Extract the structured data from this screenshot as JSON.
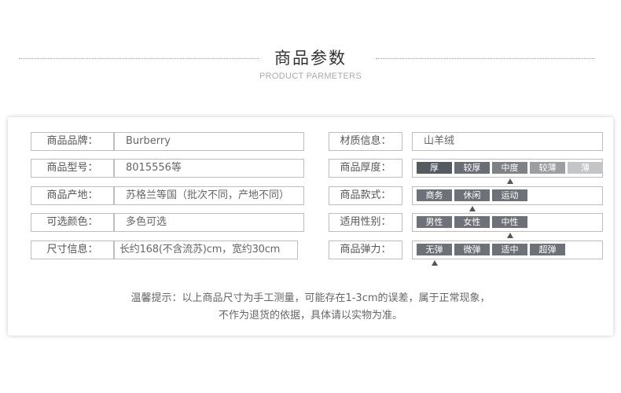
{
  "header": {
    "title": "商品参数",
    "subtitle": "PRODUCT PARMETERS"
  },
  "left_rows": [
    {
      "label": "商品品牌：",
      "value": "Burberry"
    },
    {
      "label": "商品型号：",
      "value": "8015556等"
    },
    {
      "label": "商品产地：",
      "value": "苏格兰等国（批次不同，产地不同）"
    },
    {
      "label": "可选颜色：",
      "value": "多色可选"
    },
    {
      "label": "尺寸信息：",
      "value": "长约168(不含流苏)cm，宽约30cm"
    }
  ],
  "material": {
    "label": "材质信息：",
    "value": "山羊绒"
  },
  "scales": [
    {
      "label": "商品厚度：",
      "options": [
        "厚",
        "较厚",
        "中度",
        "较薄",
        "薄"
      ],
      "selected_index": 2,
      "colors": [
        "#555a61",
        "#6a6e74",
        "#7e8286",
        "#9c9ea1",
        "#c4c5c7"
      ]
    },
    {
      "label": "商品款式：",
      "options": [
        "商务",
        "休闲",
        "运动"
      ],
      "selected_index": 1,
      "colors": [
        "#6e7278",
        "#6e7278",
        "#6e7278"
      ]
    },
    {
      "label": "适用性别：",
      "options": [
        "男性",
        "女性",
        "中性"
      ],
      "selected_index": 2,
      "colors": [
        "#6e7278",
        "#6e7278",
        "#6e7278"
      ]
    },
    {
      "label": "商品弹力：",
      "options": [
        "无弹",
        "微弹",
        "适中",
        "超弹"
      ],
      "selected_index": 0,
      "colors": [
        "#6e7278",
        "#6e7278",
        "#6e7278",
        "#6e7278"
      ]
    }
  ],
  "note": {
    "line1": "温馨提示：以上商品尺寸为手工测量，可能存在1-3cm的误差，属于正常现象，",
    "line2": "不作为退货的依据，具体请以实物为准。"
  },
  "colors": {
    "border": "#bdbdbd",
    "label_text": "#555555",
    "arrow": "#555555"
  }
}
